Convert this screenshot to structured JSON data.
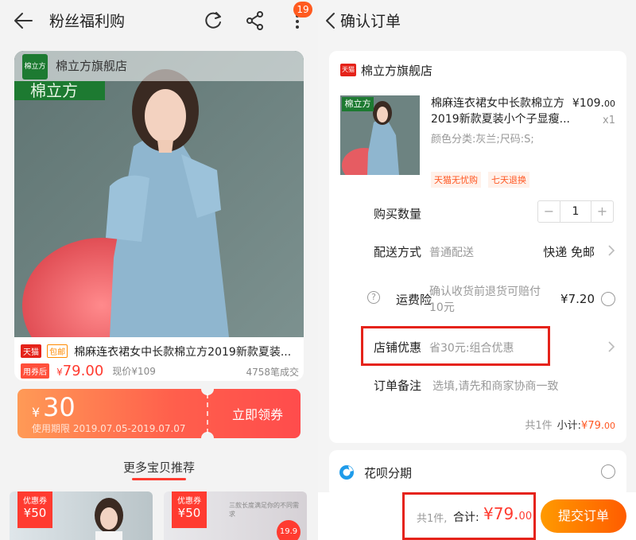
{
  "left": {
    "header": {
      "title": "粉丝福利购",
      "badge_count": "19"
    },
    "product": {
      "store_overlay_name": "棉立方旗舰店",
      "logo_small": "棉立方",
      "logo_big": "棉立方",
      "tag_tmall": "天猫",
      "tag_free": "包邮",
      "title": "棉麻连衣裙女中长款棉立方2019新款夏装...",
      "after_coupon_tag": "用券后",
      "price_currency": "¥",
      "price": "79.00",
      "original_price": "现价¥109",
      "sold": "4758笔成交"
    },
    "coupon": {
      "currency": "¥",
      "amount": "30",
      "validity": "使用期限 2019.07.05-2019.07.07",
      "cta": "立即领券"
    },
    "more_section": {
      "title": "更多宝贝推荐"
    },
    "thumbs": [
      {
        "coupon_label": "优惠券",
        "coupon_value": "¥50"
      },
      {
        "coupon_label": "优惠券",
        "coupon_value": "¥50",
        "badge": "19.9",
        "caption": "三款长度满足你的不同需求"
      }
    ]
  },
  "right": {
    "header": {
      "title": "确认订单"
    },
    "store": {
      "icon_text": "天猫",
      "name": "棉立方旗舰店"
    },
    "item": {
      "image_logo": "棉立方",
      "name": "棉麻连衣裙女中长款棉立方2019新款夏装小个子显瘦...",
      "price_int": "¥109.",
      "price_dec": "00",
      "quantity": "x1",
      "sku": "颜色分类:灰兰;尺码:S;",
      "tags": [
        "天猫无忧购",
        "七天退换"
      ]
    },
    "rows": {
      "qty_label": "购买数量",
      "qty_minus": "−",
      "qty_value": "1",
      "qty_plus": "+",
      "delivery_label": "配送方式",
      "delivery_sub": "普通配送",
      "delivery_value": "快递 免邮",
      "insurance_icon": "?",
      "insurance_label": "运费险",
      "insurance_sub_1": "确认收货前退货可赔付",
      "insurance_sub_2": "10元",
      "insurance_value": "¥7.20",
      "discount_label": "店铺优惠",
      "discount_sub": "省30元:组合优惠",
      "note_label": "订单备注",
      "note_placeholder": "选填,请先和商家协商一致"
    },
    "subtotal": {
      "count": "共1件",
      "label": "小计:",
      "currency": "¥",
      "value": "79.",
      "dec": "00"
    },
    "huabei": {
      "label": "花呗分期"
    },
    "bottom": {
      "count": "共1件,",
      "total_label": "合计:",
      "total_currency": "¥",
      "total_value": "79.",
      "total_dec": "00",
      "submit": "提交订单"
    }
  },
  "colors": {
    "accent_red": "#ff3b30",
    "orange": "#ff5c00",
    "tmall_red": "#e5231a",
    "brand_green": "#1d7a31"
  }
}
